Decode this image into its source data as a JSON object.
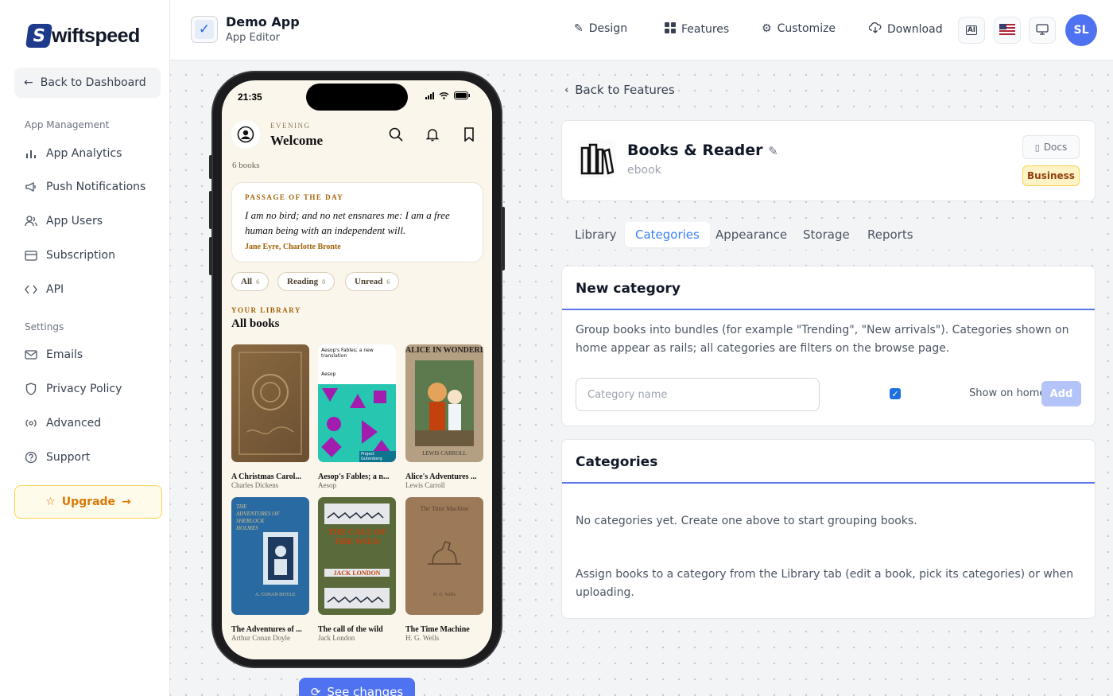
{
  "brand": {
    "logo_text": "wiftspeed",
    "logo_letter": "S"
  },
  "sidebar": {
    "back_label": "Back to Dashboard",
    "app_management_label": "App Management",
    "settings_label": "Settings",
    "items": [
      {
        "label": "App Analytics",
        "icon": "bar-chart-icon"
      },
      {
        "label": "Push Notifications",
        "icon": "megaphone-icon"
      },
      {
        "label": "App Users",
        "icon": "users-icon"
      },
      {
        "label": "Subscription",
        "icon": "credit-card-icon"
      },
      {
        "label": "API",
        "icon": "code-icon"
      },
      {
        "label": "Emails",
        "icon": "mail-icon"
      },
      {
        "label": "Privacy Policy",
        "icon": "shield-icon"
      },
      {
        "label": "Advanced",
        "icon": "broadcast-icon"
      },
      {
        "label": "Support",
        "icon": "help-circle-icon"
      }
    ],
    "upgrade_label": "Upgrade"
  },
  "header": {
    "app_name": "Demo App",
    "app_subtitle": "App Editor",
    "nav": {
      "design": "Design",
      "features": "Features",
      "customize": "Customize",
      "download": "Download"
    },
    "ai_label": "AI",
    "avatar_initials": "SL"
  },
  "phone": {
    "time": "21:35",
    "greeting_small": "EVENING",
    "greeting": "Welcome",
    "book_count": "6 books",
    "passage": {
      "label": "PASSAGE OF THE DAY",
      "text": "I am no bird; and no net ensnares me: I am a free human being with an independent will.",
      "author": "Jane Eyre, Charlotte Bronte"
    },
    "chips": [
      {
        "label": "All",
        "count": "6"
      },
      {
        "label": "Reading",
        "count": "0"
      },
      {
        "label": "Unread",
        "count": "6"
      }
    ],
    "library_label": "YOUR LIBRARY",
    "library_title": "All books",
    "books": [
      {
        "title": "A Christmas Carol...",
        "author": "Charles Dickens"
      },
      {
        "title": "Aesop's Fables; a n...",
        "author": "Aesop",
        "cover_title": "Aesop's Fables; a new translation",
        "cover_author": "Aesop",
        "cover_footer": "Project Gutenberg"
      },
      {
        "title": "Alice's Adventures ...",
        "author": "Lewis Carroll",
        "cover_title": "ALICE IN WONDERLAND",
        "cover_author": "LEWIS CARROLL"
      },
      {
        "title": "The Adventures of ...",
        "author": "Arthur Conan Doyle",
        "cover_title": "THE ADVENTURES OF SHERLOCK HOLMES",
        "cover_author": "A. CONAN DOYLE"
      },
      {
        "title": "The call of the wild",
        "author": "Jack London",
        "cover_title": "THE CALL OF THE WILD",
        "cover_author": "JACK LONDON"
      },
      {
        "title": "The Time Machine",
        "author": "H. G. Wells",
        "cover_title": "The Time Machine",
        "cover_author": "H. G. Wells"
      }
    ],
    "see_changes": "See changes"
  },
  "panel": {
    "back_label": "Back to Features",
    "feature_title": "Books & Reader",
    "feature_sub": "ebook",
    "docs_label": "Docs",
    "badge_label": "Business",
    "tabs": [
      "Library",
      "Categories",
      "Appearance",
      "Storage",
      "Reports"
    ],
    "active_tab": "Categories",
    "new_category": {
      "heading": "New category",
      "description": "Group books into bundles (for example \"Trending\", \"New arrivals\"). Categories shown on home appear as rails; all categories are filters on the browse page.",
      "input_placeholder": "Category name",
      "show_home_checked": true,
      "show_home_label": "Show on home",
      "add_label": "Add"
    },
    "categories": {
      "heading": "Categories",
      "empty_text": "No categories yet. Create one above to start grouping books.",
      "help_text": "Assign books to a category from the Library tab (edit a book, pick its categories) or when uploading."
    }
  },
  "colors": {
    "accent": "#4f72f0",
    "tab_active": "#3b82f6",
    "upgrade": "#d97706",
    "badge_bg": "#fef3c7"
  }
}
